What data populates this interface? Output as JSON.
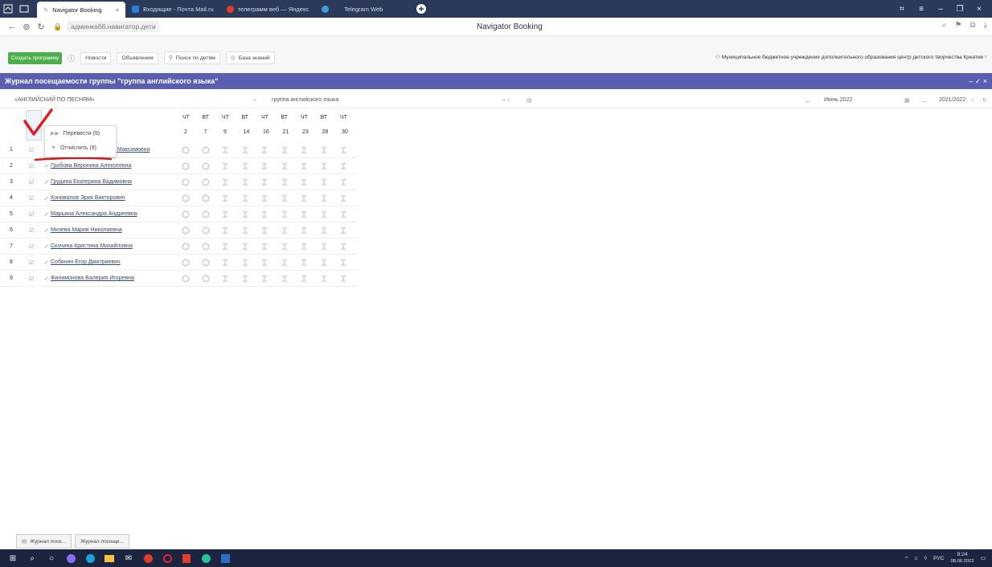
{
  "browser": {
    "tabs": [
      {
        "label": "Navigator Booking",
        "close": "×",
        "active": true
      },
      {
        "label": "Входящие - Почта Mail.ru"
      },
      {
        "label": "телеграмм веб — Яндекс"
      },
      {
        "label": "Telegram Web"
      }
    ],
    "url": "админкаб6.навигатор.дети",
    "page_title": "Navigator Booking"
  },
  "toolbar": {
    "create_label": "Создать программу",
    "news_label": "Новости",
    "ads_label": "Объявления",
    "search_children_label": "Поиск по детям",
    "knowledge_label": "База знаний",
    "organization": "Муниципальное бюджетное учреждение дополнительного образования центр детского творчества Креатив"
  },
  "panel": {
    "title": "Журнал посещаемости группы \"группа английского языка\"",
    "window_controls": "– ✓ ×"
  },
  "filters": {
    "program": "«АНГЛИЙСКИЙ ПО ПЕСНЯМ»",
    "group": "группа английского языка",
    "month": "Июнь 2022",
    "year": "2021/2022"
  },
  "journal": {
    "days": [
      {
        "dow": "ЧТ",
        "date": "2"
      },
      {
        "dow": "ВТ",
        "date": "7"
      },
      {
        "dow": "ЧТ",
        "date": "9"
      },
      {
        "dow": "ВТ",
        "date": "14"
      },
      {
        "dow": "ЧТ",
        "date": "16"
      },
      {
        "dow": "ВТ",
        "date": "21"
      },
      {
        "dow": "ЧТ",
        "date": "23"
      },
      {
        "dow": "ВТ",
        "date": "28"
      },
      {
        "dow": "ЧТ",
        "date": "30"
      }
    ],
    "students": [
      {
        "num": "1",
        "name": "а Максимовна"
      },
      {
        "num": "2",
        "name": "Грибова Вероника Алексеевна"
      },
      {
        "num": "3",
        "name": "Грудина Екатерина Вадимовна"
      },
      {
        "num": "4",
        "name": "Коновалов Эрик Викторович"
      },
      {
        "num": "5",
        "name": "Марьина Александра Андреевна"
      },
      {
        "num": "6",
        "name": "Мизева Мария Николаевна"
      },
      {
        "num": "7",
        "name": "Скочина Кристина Михайловна"
      },
      {
        "num": "8",
        "name": "Собянин Егор Дмитриевич"
      },
      {
        "num": "9",
        "name": "Филимонова Валерия Игоревна"
      }
    ]
  },
  "context_menu": {
    "items": [
      {
        "label": "Перевести (9)"
      },
      {
        "label": "Отчислить (9)"
      }
    ]
  },
  "bottom_tabs": [
    "Журнал посе...",
    "Журнал посеще..."
  ],
  "taskbar": {
    "lang": "РУС",
    "time": "9:24",
    "date": "08.06.2022"
  }
}
